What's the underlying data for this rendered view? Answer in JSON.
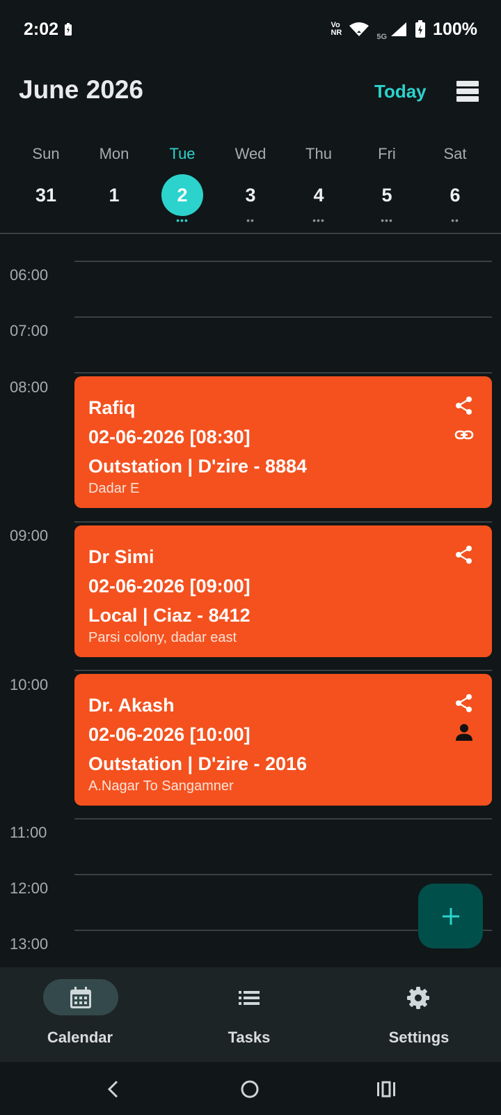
{
  "status_bar": {
    "time": "2:02",
    "volte_top": "Vo",
    "volte_bottom": "NR",
    "network": "5G",
    "battery": "100%"
  },
  "header": {
    "title": "June 2026",
    "today_label": "Today"
  },
  "week": [
    {
      "name": "Sun",
      "num": "31",
      "dots": "",
      "selected": false
    },
    {
      "name": "Mon",
      "num": "1",
      "dots": "",
      "selected": false
    },
    {
      "name": "Tue",
      "num": "2",
      "dots": "•••",
      "selected": true
    },
    {
      "name": "Wed",
      "num": "3",
      "dots": "••",
      "selected": false
    },
    {
      "name": "Thu",
      "num": "4",
      "dots": "•••",
      "selected": false
    },
    {
      "name": "Fri",
      "num": "5",
      "dots": "•••",
      "selected": false
    },
    {
      "name": "Sat",
      "num": "6",
      "dots": "••",
      "selected": false
    }
  ],
  "timeline": {
    "hours": [
      "06:00",
      "07:00",
      "08:00",
      "09:00",
      "10:00",
      "11:00",
      "12:00",
      "13:00"
    ]
  },
  "events": [
    {
      "name": "Rafiq",
      "date": "02-06-2026 [08:30]",
      "detail": "Outstation | D'zire - 8884",
      "location": "Dadar E",
      "secondary_icon": "link-icon"
    },
    {
      "name": "Dr Simi",
      "date": "02-06-2026 [09:00]",
      "detail": "Local | Ciaz - 8412",
      "location": "Parsi colony, dadar east",
      "secondary_icon": ""
    },
    {
      "name": "Dr. Akash",
      "date": "02-06-2026 [10:00]",
      "detail": "Outstation | D'zire - 2016",
      "location": "A.Nagar To Sangamner",
      "secondary_icon": "person-icon"
    }
  ],
  "bottom_nav": {
    "calendar": "Calendar",
    "tasks": "Tasks",
    "settings": "Settings"
  },
  "colors": {
    "accent": "#2cd3cc",
    "event": "#f4511e",
    "background": "#111618",
    "fab": "#004f4a"
  }
}
